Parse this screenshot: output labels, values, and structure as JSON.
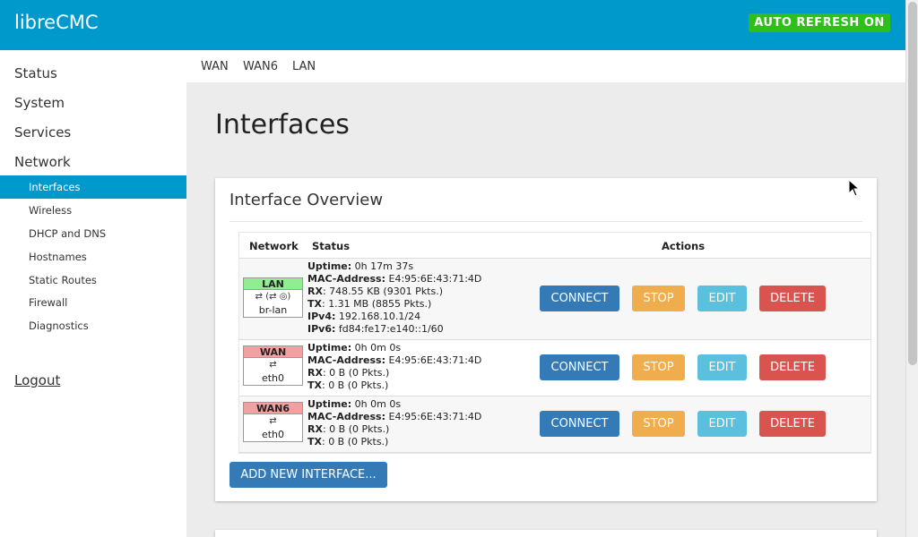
{
  "header": {
    "brand": "libreCMC",
    "auto_refresh": "AUTO REFRESH ON"
  },
  "sidebar": {
    "sections": [
      "Status",
      "System",
      "Services",
      "Network"
    ],
    "network_items": [
      "Interfaces",
      "Wireless",
      "DHCP and DNS",
      "Hostnames",
      "Static Routes",
      "Firewall",
      "Diagnostics"
    ],
    "active": "Interfaces",
    "logout": "Logout"
  },
  "tabs": [
    "WAN",
    "WAN6",
    "LAN"
  ],
  "page": {
    "title": "Interfaces",
    "panel_title": "Interface Overview"
  },
  "table": {
    "headers": [
      "Network",
      "Status",
      "Actions"
    ],
    "interfaces": [
      {
        "name": "LAN",
        "color": "#90ee90",
        "device": "br-lan",
        "icons": "⇄ (⇄ ◎)",
        "uptime": "0h 17m 37s",
        "mac": "E4:95:6E:43:71:4D",
        "rx": "748.55 KB (9301 Pkts.)",
        "tx": "1.31 MB (8855 Pkts.)",
        "ipv4": "192.168.10.1/24",
        "ipv6": "fd84:fe17:e140::1/60"
      },
      {
        "name": "WAN",
        "color": "#f4a0a0",
        "device": "eth0",
        "icons": "⇄",
        "uptime": "0h 0m 0s",
        "mac": "E4:95:6E:43:71:4D",
        "rx": "0 B (0 Pkts.)",
        "tx": "0 B (0 Pkts.)"
      },
      {
        "name": "WAN6",
        "color": "#f4a0a0",
        "device": "eth0",
        "icons": "⇄",
        "uptime": "0h 0m 0s",
        "mac": "E4:95:6E:43:71:4D",
        "rx": "0 B (0 Pkts.)",
        "tx": "0 B (0 Pkts.)"
      }
    ],
    "labels": {
      "uptime": "Uptime:",
      "mac": "MAC-Address:",
      "rx": "RX",
      "tx": "TX",
      "ipv4": "IPv4:",
      "ipv6": "IPv6:"
    },
    "actions": {
      "connect": "CONNECT",
      "stop": "STOP",
      "edit": "EDIT",
      "delete": "DELETE"
    }
  },
  "add_button": "ADD NEW INTERFACE..."
}
